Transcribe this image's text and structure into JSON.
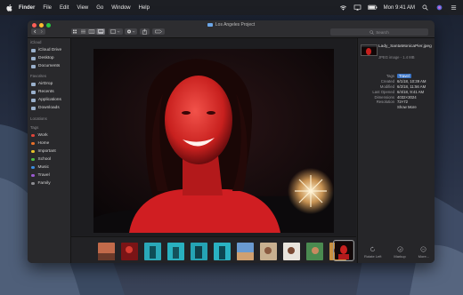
{
  "menubar": {
    "app": "Finder",
    "items": [
      "File",
      "Edit",
      "View",
      "Go",
      "Window",
      "Help"
    ],
    "clock": "Mon 9:41 AM"
  },
  "window": {
    "title": "Los Angeles Project",
    "search_placeholder": "Search"
  },
  "sidebar": {
    "icloud_header": "iCloud",
    "icloud": [
      {
        "label": "iCloud Drive",
        "icon": "cloud-icon"
      },
      {
        "label": "Desktop",
        "icon": "desktop-icon"
      },
      {
        "label": "Documents",
        "icon": "document-icon"
      }
    ],
    "favorites_header": "Favorites",
    "favorites": [
      {
        "label": "AirDrop",
        "icon": "airdrop-icon"
      },
      {
        "label": "Recents",
        "icon": "clock-icon"
      },
      {
        "label": "Applications",
        "icon": "applications-icon"
      },
      {
        "label": "Downloads",
        "icon": "download-icon"
      }
    ],
    "locations_header": "Locations",
    "tags_header": "Tags",
    "tags": [
      {
        "label": "Work",
        "color": "#e0453a"
      },
      {
        "label": "Home",
        "color": "#e8702a"
      },
      {
        "label": "Important",
        "color": "#e8c22a"
      },
      {
        "label": "School",
        "color": "#4cbb45"
      },
      {
        "label": "Music",
        "color": "#3b8de0"
      },
      {
        "label": "Travel",
        "color": "#9b59d0"
      },
      {
        "label": "Family",
        "color": "#8e8e93"
      }
    ]
  },
  "inspector": {
    "filename": "Lady_SantaMonicaPier.jpeg",
    "kind": "JPEG image - 1.4 MB",
    "rows": [
      {
        "k": "Tags",
        "v": "Travel"
      },
      {
        "k": "Created",
        "v": "6/1/18, 10:39 AM"
      },
      {
        "k": "Modified",
        "v": "6/2/18, 11:56 AM"
      },
      {
        "k": "Last Opened",
        "v": "6/4/18, 9:41 AM"
      },
      {
        "k": "Dimensions",
        "v": "4032×3024"
      },
      {
        "k": "Resolution",
        "v": "72×72"
      }
    ],
    "show_more": "Show More",
    "actions": [
      "Rotate Left",
      "Markup",
      "More..."
    ]
  },
  "filmstrip": {
    "count": 12,
    "selected_index": 11
  },
  "colors": {
    "accent": "#3b74c4",
    "link": "#4a90e2",
    "close": "#ff5f57",
    "minimize": "#febc2e",
    "zoom": "#28c840"
  }
}
